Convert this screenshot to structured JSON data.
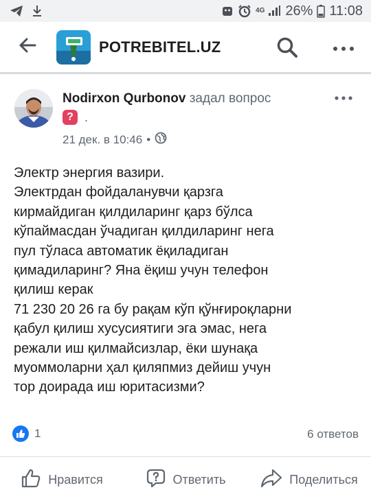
{
  "status_bar": {
    "battery": "26%",
    "time": "11:08",
    "network": "4G"
  },
  "header": {
    "title": "POTREBITEL.UZ",
    "icons": [
      "back-arrow-icon",
      "search-icon",
      "more-horizontal-icon"
    ]
  },
  "post": {
    "author": "Nodirxon Qurbonov",
    "action": " задал вопрос",
    "question_dot": ".",
    "date": "21 дек. в 10:46",
    "date_separator": "•",
    "privacy_icon": "globe-icon",
    "body_lines": [
      "Электр энергия вазири.",
      "Электрдан фойдаланувчи қарзга",
      "кирмайдиган қилдиларинг қарз бўлса",
      "кўпаймасдан ўчадиган қилдиларинг нега",
      "пул тўласа автоматик ёқиладиган",
      "қимадиларинг?  Яна ёқиш учун телефон",
      "қилиш керак",
      "71 230 20 26 га бу рақам кўп қўнғироқларни",
      "қабул қилиш хусусиятиги эга эмас, нега",
      "режали иш қилмайсизлар, ёки шунақа",
      "муоммоларни ҳал қиляпмиз дейиш учун",
      "тор доирада иш юритасизми?"
    ],
    "likes_count": "1",
    "answers_count": "6 ответов"
  },
  "actions": {
    "like_label": "Нравится",
    "answer_label": "Ответить",
    "share_label": "Поделиться"
  },
  "colors": {
    "facebook_blue": "#1877f2",
    "question_badge": "#e4405f",
    "secondary_text": "#606770"
  }
}
